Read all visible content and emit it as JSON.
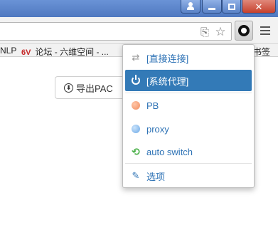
{
  "window": {
    "buttons": [
      "user-icon",
      "minimize-icon",
      "maximize-icon",
      "close-icon"
    ]
  },
  "toolbar": {
    "icons": [
      "translate-icon",
      "star-icon",
      "switchyomega-icon",
      "hamburger-menu-icon"
    ]
  },
  "bookmarks": {
    "items": [
      {
        "label": "NLP"
      },
      {
        "label": "论坛 - 六维空间 - ...",
        "logo": "6V"
      },
      {
        "label": "书签"
      }
    ]
  },
  "page": {
    "export_button_label": "导出PAC",
    "export_icon": "⬇"
  },
  "popup": {
    "items": [
      {
        "label": "[直接连接]",
        "icon": "direct-arrows-icon",
        "glyph": "⇄"
      },
      {
        "label": "[系统代理]",
        "icon": "power-icon",
        "active": true
      },
      {
        "label": "PB",
        "icon": "globe-icon",
        "color": "#f08c5e"
      },
      {
        "label": "proxy",
        "icon": "globe-icon",
        "color": "#6aa8e6"
      },
      {
        "label": "auto switch",
        "icon": "cycle-icon",
        "glyph": "⟲",
        "color": "#4cb14a"
      },
      {
        "label": "选项",
        "icon": "wrench-icon",
        "glyph": "🔧"
      }
    ],
    "accent": "#337ab7",
    "text_color": "#2d72b5"
  }
}
